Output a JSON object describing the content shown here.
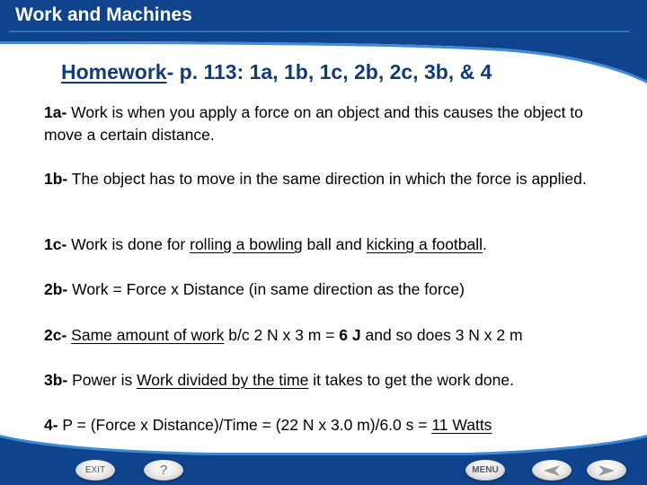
{
  "header": {
    "chapter_title": "Work and Machines"
  },
  "slide": {
    "title_underlined": "Homework",
    "title_rest": "- p. 113: 1a, 1b, 1c, 2b, 2c, 3b, & 4",
    "answers": {
      "a1a": {
        "label": "1a-",
        "text": " Work is when you apply a force on an object and this causes the object to move a certain distance."
      },
      "a1b": {
        "label": "1b-",
        "text": " The object has to move in the same direction in which the force is applied."
      },
      "a1c": {
        "label": "1c-",
        "t1": " Work is done for ",
        "u1": "rolling a bowling",
        "t2": " ball and ",
        "u2": "kicking a football",
        "t3": "."
      },
      "a2b": {
        "label": "2b-",
        "text": " Work = Force x Distance (in same direction as the force)"
      },
      "a2c": {
        "label": "2c-",
        "t1": " ",
        "u1": "Same amount of work",
        "t2": " b/c 2 N x 3 m = ",
        "b1": "6 J",
        "t3": " and so does 3 N x 2 m"
      },
      "a3b": {
        "label": "3b-",
        "t1": " Power is ",
        "u1": "Work divided by the time",
        "t2": " it takes to get the work done."
      },
      "a4": {
        "label": "4-",
        "t1": " P = (Force x Distance)/Time = (22 N x 3.0 m)/6.0 s = ",
        "u1": "11 Watts"
      }
    }
  },
  "footer": {
    "exit_label": "EXIT",
    "help_label": "?",
    "menu_label": "MENU",
    "prev_icon": "left-arrow",
    "next_icon": "right-arrow"
  },
  "colors": {
    "brand_blue": "#0f438c",
    "accent_light_blue": "#3f8ad8",
    "title_blue": "#133c76"
  }
}
